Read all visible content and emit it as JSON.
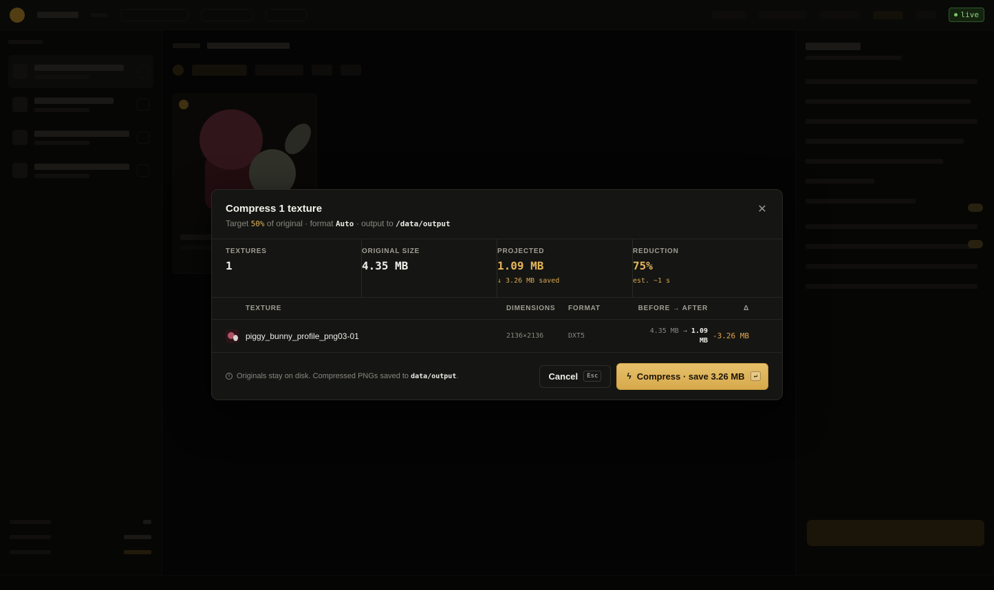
{
  "topbar": {
    "live_label": "live"
  },
  "modal": {
    "title": "Compress 1 texture",
    "subtitle": {
      "target_prefix": "Target ",
      "target_value": "50%",
      "target_suffix": " of original · format ",
      "format_value": "Auto",
      "output_prefix": " · output to ",
      "output_path": "/data/output"
    },
    "close_glyph": "✕",
    "stats": [
      {
        "label": "TEXTURES",
        "value": "1",
        "note": ""
      },
      {
        "label": "ORIGINAL SIZE",
        "value": "4.35 MB",
        "note": ""
      },
      {
        "label": "PROJECTED",
        "value": "1.09 MB",
        "note": "↓ 3.26 MB saved"
      },
      {
        "label": "REDUCTION",
        "value": "75%",
        "note": "est. ~1 s"
      }
    ],
    "table": {
      "headers": {
        "texture": "TEXTURE",
        "dimensions": "DIMENSIONS",
        "format": "FORMAT",
        "before_after": "BEFORE → AFTER",
        "delta": "Δ"
      },
      "rows": [
        {
          "name": "piggy_bunny_profile_png03-01",
          "dimensions": "2136×2136",
          "format": "DXT5",
          "before": "4.35 MB",
          "arrow": " → ",
          "after": "1.09",
          "after_unit": "MB",
          "delta": "-3.26 MB"
        }
      ]
    },
    "footer": {
      "info_prefix": "Originals stay on disk. Compressed PNGs saved to ",
      "info_path": "data/output",
      "info_suffix": ".",
      "cancel_label": "Cancel",
      "cancel_key": "Esc",
      "primary_label": "Compress · save 3.26 MB",
      "primary_key": "↵"
    }
  },
  "colors": {
    "accent": "#e0b65a",
    "accent_button": "#d7a94c",
    "background": "#0b0b0a",
    "modal": "#151513",
    "live": "#8fd27f"
  },
  "icons": {
    "close": "close-icon",
    "info": "info-icon",
    "bolt": "lightning-icon",
    "enter": "enter-key-icon"
  }
}
